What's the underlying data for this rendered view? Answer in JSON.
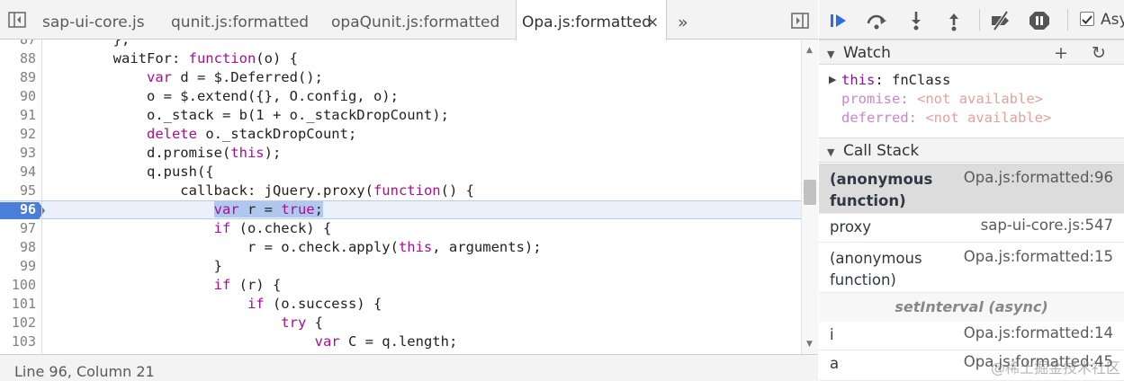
{
  "tabs": [
    {
      "label": "sap-ui-core.js",
      "active": false
    },
    {
      "label": "qunit.js:formatted",
      "active": false
    },
    {
      "label": "opaQunit.js:formatted",
      "active": false
    },
    {
      "label": "Opa.js:formatted",
      "active": true
    }
  ],
  "tab_close_glyph": "×",
  "tab_overflow_glyph": "»",
  "code": {
    "execution_line": "96",
    "lines": [
      {
        "n": "87",
        "text": "        },"
      },
      {
        "n": "88",
        "text": "        waitFor: function(o) {"
      },
      {
        "n": "89",
        "text": "            var d = $.Deferred();"
      },
      {
        "n": "90",
        "text": "            o = $.extend({}, O.config, o);"
      },
      {
        "n": "91",
        "text": "            o._stack = b(1 + o._stackDropCount);"
      },
      {
        "n": "92",
        "text": "            delete o._stackDropCount;"
      },
      {
        "n": "93",
        "text": "            d.promise(this);"
      },
      {
        "n": "94",
        "text": "            q.push({"
      },
      {
        "n": "95",
        "text": "                callback: jQuery.proxy(function() {"
      },
      {
        "n": "96",
        "text": "                    var r = true;"
      },
      {
        "n": "97",
        "text": "                    if (o.check) {"
      },
      {
        "n": "98",
        "text": "                        r = o.check.apply(this, arguments);"
      },
      {
        "n": "99",
        "text": "                    }"
      },
      {
        "n": "100",
        "text": "                    if (r) {"
      },
      {
        "n": "101",
        "text": "                        if (o.success) {"
      },
      {
        "n": "102",
        "text": "                            try {"
      },
      {
        "n": "103",
        "text": "                                var C = q.length;"
      }
    ]
  },
  "status": {
    "cursor": "Line 96, Column 21"
  },
  "debugger_toolbar": {
    "buttons": [
      "resume-icon",
      "step-over-icon",
      "step-into-icon",
      "step-out-icon",
      "deactivate-breakpoints-icon",
      "pause-on-exceptions-icon"
    ],
    "async_label": "Async",
    "async_checked": true
  },
  "watch": {
    "title": "Watch",
    "add_glyph": "+",
    "refresh_glyph": "↻",
    "items": [
      {
        "name": "this",
        "value": "fnClass",
        "expandable": true,
        "available": true
      },
      {
        "name": "promise",
        "value": "<not available>",
        "expandable": false,
        "available": false
      },
      {
        "name": "deferred",
        "value": "<not available>",
        "expandable": false,
        "available": false
      }
    ]
  },
  "call_stack": {
    "title": "Call Stack",
    "frames": [
      {
        "fn": "(anonymous function)",
        "loc": "Opa.js:formatted:96",
        "selected": true
      },
      {
        "fn": "proxy",
        "loc": "sap-ui-core.js:547",
        "selected": false
      },
      {
        "fn": "(anonymous function)",
        "loc": "Opa.js:formatted:15",
        "selected": false
      }
    ],
    "async_separator": "setInterval (async)",
    "frames_after_async": [
      {
        "fn": "i",
        "loc": "Opa.js:formatted:14"
      },
      {
        "fn": "a",
        "loc": "Opa.js:formatted:45"
      }
    ]
  },
  "watermark": "@稀土掘金技术社区",
  "colors": {
    "keyword": "#aa0d91",
    "execution_line_bg": "#eaf1fb",
    "breakpoint_marker": "#4a7ed8",
    "selection": "#b1c8ee",
    "resume_button": "#2c6fe0"
  }
}
